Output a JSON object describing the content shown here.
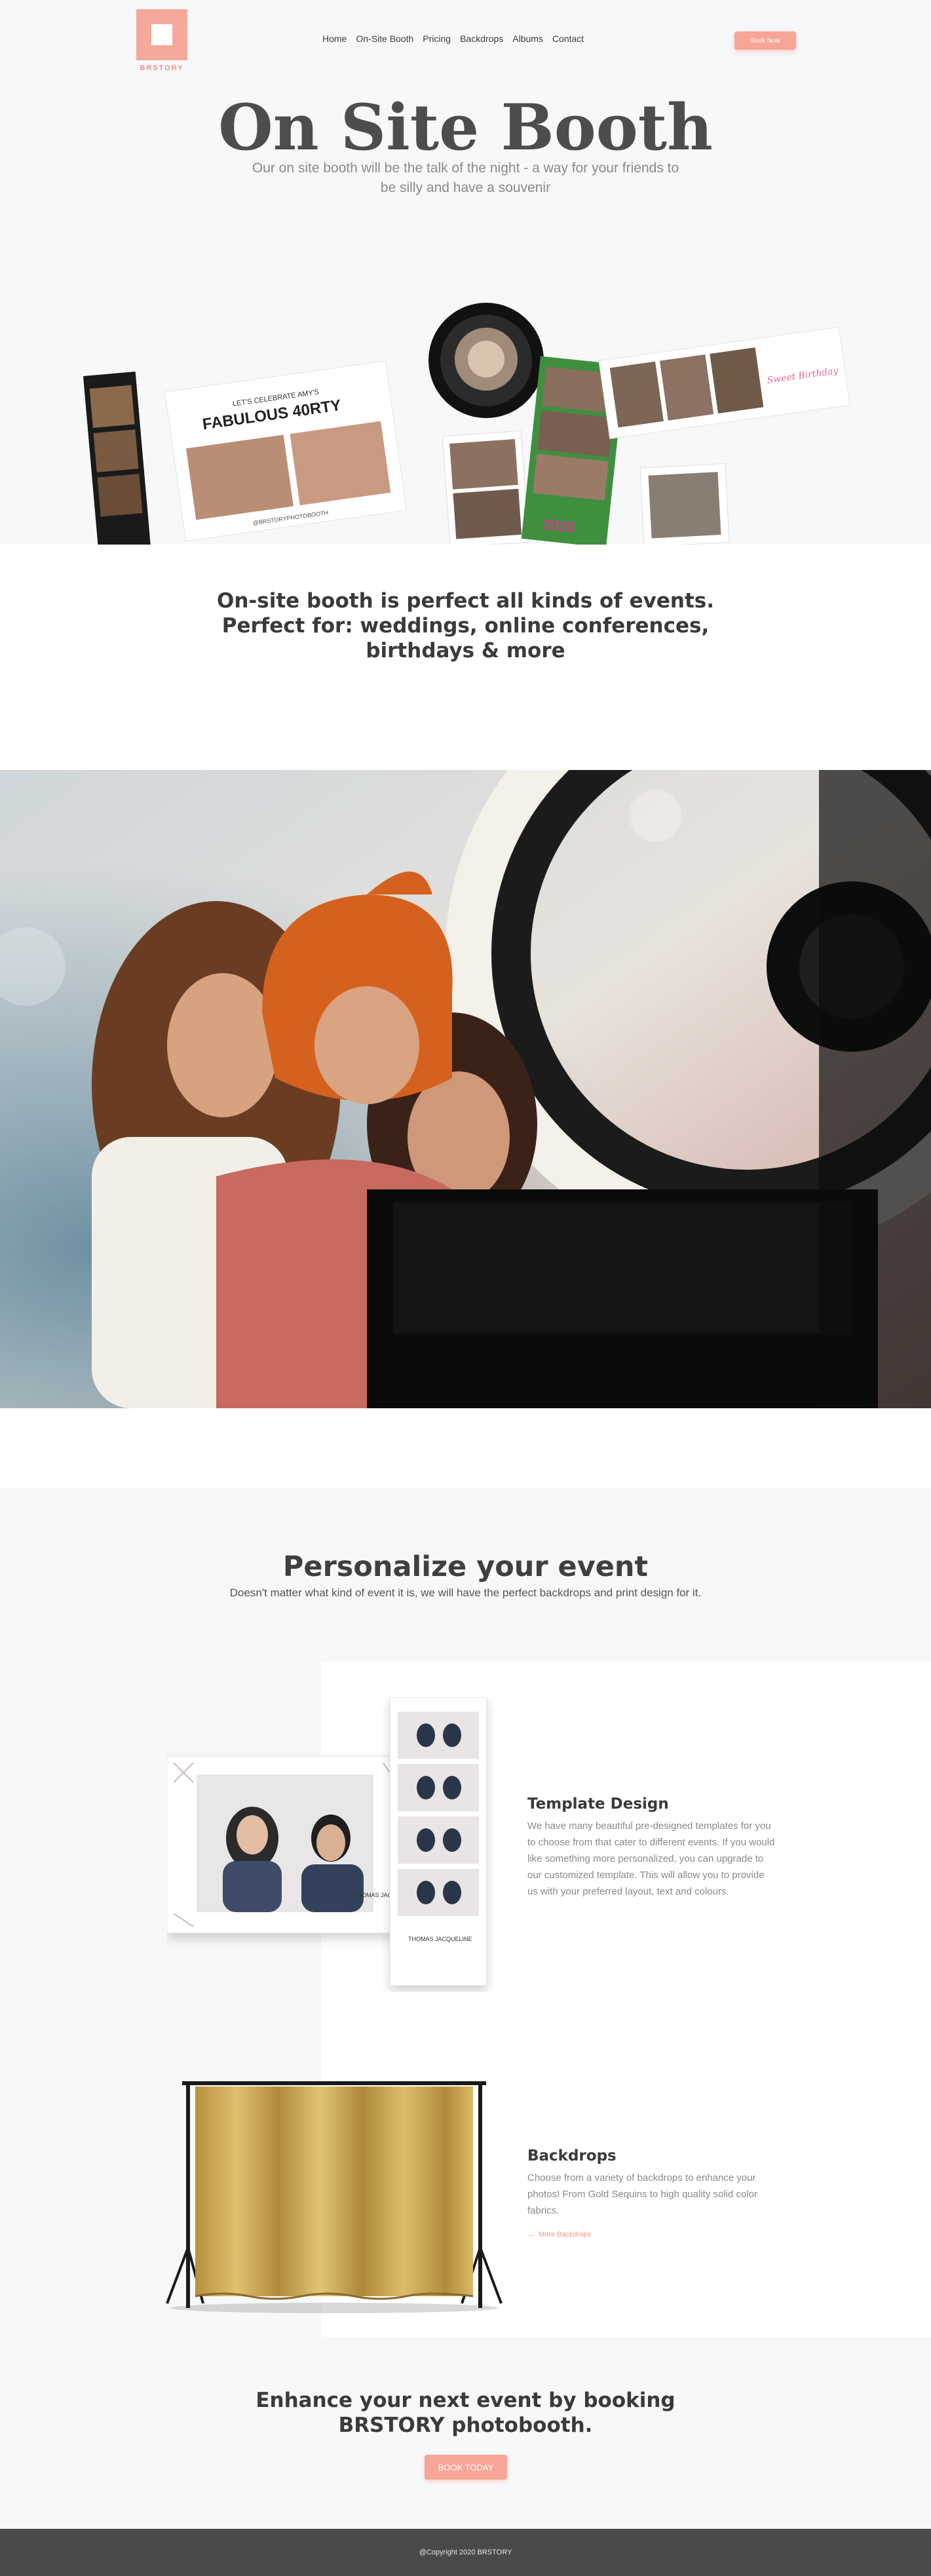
{
  "header": {
    "logo_text": "BRSTORY",
    "nav": [
      "Home",
      "On-Site Booth",
      "Pricing",
      "Backdrops",
      "Albums",
      "Contact"
    ],
    "book_now": "Book Now"
  },
  "hero": {
    "title": "On Site Booth",
    "subtitle": "Our on site booth will be the talk of the night - a way for your friends to be silly and have a souvenir"
  },
  "collage": {
    "strip_text": "FABULOUS 40RTY",
    "strip_small": "LET'S CELEBRATE AMY'S",
    "hashtag": "@BRSTORYPHOTOBOOTH",
    "year": "2020",
    "card_text": "Sweet Birthday"
  },
  "perfect_for": "On-site booth is perfect all kinds of events. Perfect for: weddings, online conferences, birthdays & more",
  "personalize": {
    "title": "Personalize your event",
    "subtitle": "Doesn't matter what kind of event it is, we will have the perfect backdrops and print design for it."
  },
  "features": [
    {
      "title": "Template Design",
      "text": "We have many beautiful pre-designed templates for you to choose from that cater to different events. If you would like something more personalized, you can upgrade to our customized template. This will allow you to provide us with your preferred layout, text and colours."
    },
    {
      "title": "Backdrops",
      "text": "Choose from a variety of backdrops to enhance your photos! From Gold Sequins to high quality solid color fabrics.",
      "link": "More Backdrops"
    }
  ],
  "template_names": {
    "big": "THOMAS JACQUELINE",
    "strip": "THOMAS JACQUELINE"
  },
  "cta": {
    "title": "Enhance your next event by booking BRSTORY photobooth.",
    "button": "BOOK TODAY"
  },
  "footer": "@Copyright 2020 BRSTORY",
  "colors": {
    "accent": "#f6a597",
    "dark": "#4a4a4a",
    "bg": "#f7f8fa"
  }
}
